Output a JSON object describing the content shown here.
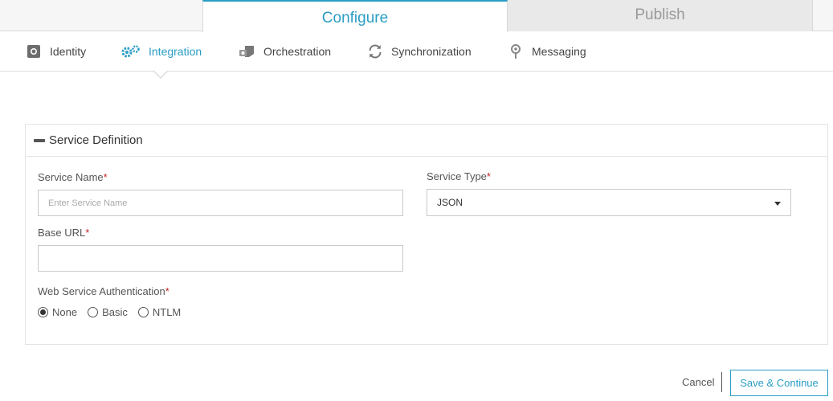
{
  "top_tabs": [
    {
      "label": "Configure",
      "active": true
    },
    {
      "label": "Publish",
      "active": false
    }
  ],
  "subnav": [
    {
      "label": "Identity",
      "icon": "identity-icon"
    },
    {
      "label": "Integration",
      "icon": "gears-icon",
      "active": true
    },
    {
      "label": "Orchestration",
      "icon": "orchestration-icon"
    },
    {
      "label": "Synchronization",
      "icon": "sync-icon"
    },
    {
      "label": "Messaging",
      "icon": "messaging-icon"
    }
  ],
  "panel": {
    "title": "Service Definition",
    "service_name": {
      "label": "Service Name",
      "required": "*",
      "placeholder": "Enter Service Name",
      "value": ""
    },
    "service_type": {
      "label": "Service Type",
      "required": "*",
      "value": "JSON"
    },
    "base_url": {
      "label": "Base URL",
      "required": "*",
      "value": ""
    },
    "auth": {
      "label": "Web Service Authentication",
      "required": "*",
      "options": [
        "None",
        "Basic",
        "NTLM"
      ],
      "selected": "None"
    }
  },
  "footer": {
    "cancel_label": "Cancel",
    "save_label": "Save & Continue"
  },
  "colors": {
    "accent": "#2a9dc4",
    "required": "#c0262d"
  }
}
